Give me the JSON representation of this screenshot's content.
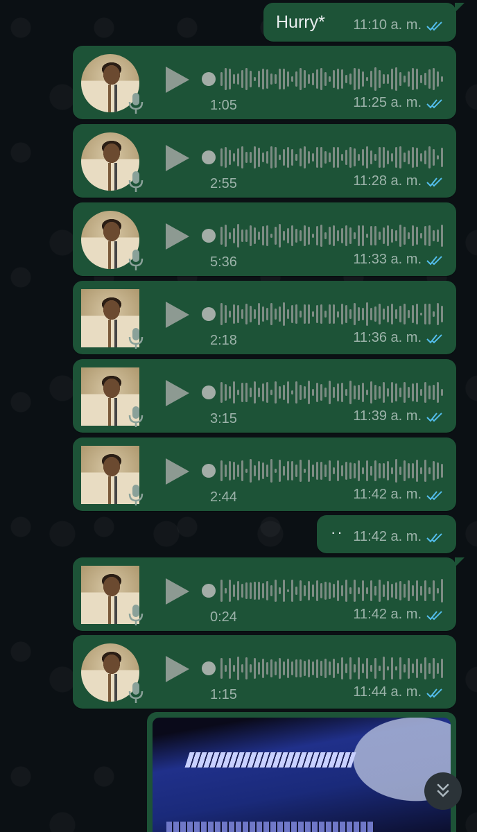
{
  "colors": {
    "bubble": "#1d5337",
    "background": "#0b1014",
    "tick_blue": "#53bdeb"
  },
  "messages": {
    "top_text": {
      "text": "Hurry*",
      "time": "11:10 a. m."
    },
    "voice": [
      {
        "duration": "1:05",
        "time": "11:25 a. m.",
        "avatar_shape": "round"
      },
      {
        "duration": "2:55",
        "time": "11:28 a. m.",
        "avatar_shape": "round"
      },
      {
        "duration": "5:36",
        "time": "11:33 a. m.",
        "avatar_shape": "round"
      },
      {
        "duration": "2:18",
        "time": "11:36 a. m.",
        "avatar_shape": "square"
      },
      {
        "duration": "3:15",
        "time": "11:39 a. m.",
        "avatar_shape": "square"
      },
      {
        "duration": "2:44",
        "time": "11:42 a. m.",
        "avatar_shape": "square"
      },
      {
        "duration": "0:24",
        "time": "11:42 a. m.",
        "avatar_shape": "square"
      },
      {
        "duration": "1:15",
        "time": "11:44 a. m.",
        "avatar_shape": "round"
      }
    ],
    "dots_text": {
      "text": "··",
      "time": "11:42 a. m."
    }
  },
  "icons": {
    "play": "play-icon",
    "mic": "microphone-icon",
    "read_receipt": "double-check-icon",
    "scroll_down": "double-chevron-down-icon"
  }
}
